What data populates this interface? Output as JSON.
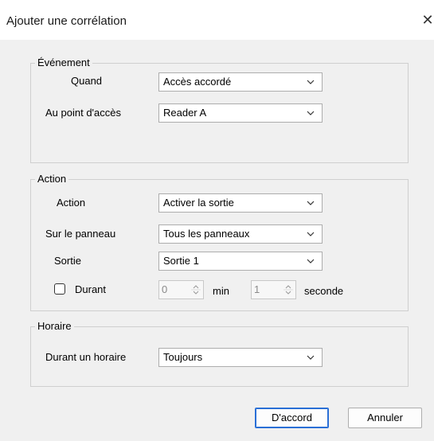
{
  "window": {
    "title": "Ajouter une corrélation",
    "close_icon": "close-icon"
  },
  "event_group": {
    "legend": "Événement",
    "when_label": "Quand",
    "when_value": "Accès accordé",
    "access_point_label": "Au point d'accès",
    "access_point_value": "Reader A"
  },
  "action_group": {
    "legend": "Action",
    "action_label": "Action",
    "action_value": "Activer la sortie",
    "panel_label": "Sur le panneau",
    "panel_value": "Tous les panneaux",
    "output_label": "Sortie",
    "output_value": "Sortie 1",
    "duration_checkbox_label": "Durant",
    "duration_checked": false,
    "minutes_value": "0",
    "minutes_unit": "min",
    "seconds_value": "1",
    "seconds_unit": "seconde"
  },
  "schedule_group": {
    "legend": "Horaire",
    "schedule_label": "Durant un horaire",
    "schedule_value": "Toujours"
  },
  "buttons": {
    "ok_label": "D'accord",
    "cancel_label": "Annuler"
  },
  "colors": {
    "background": "#f0f0f0",
    "default_button_border": "#2a6fd6"
  }
}
